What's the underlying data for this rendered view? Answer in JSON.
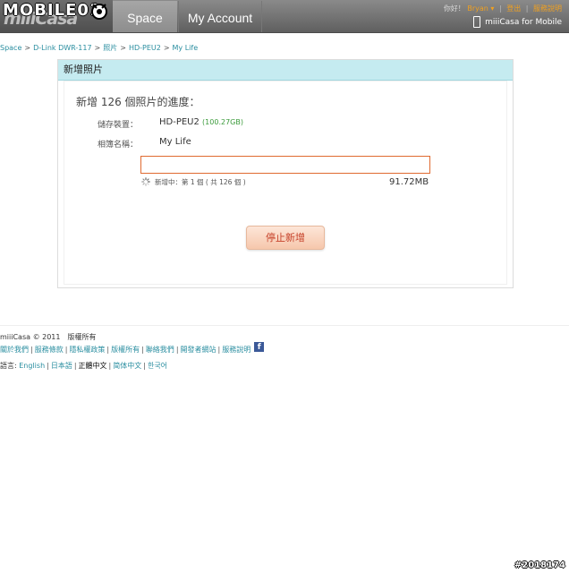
{
  "watermark": {
    "top": "MOBILE01",
    "bottom": "#2018174"
  },
  "brand": {
    "logo_text": "miiiCasa"
  },
  "nav": {
    "tabs": [
      {
        "label": "Space"
      },
      {
        "label": "My Account"
      }
    ]
  },
  "user_bar": {
    "greeting": "你好！",
    "username": "Bryan",
    "logout": "登出",
    "help": "服務說明",
    "mobile_link": "miiiCasa for Mobile"
  },
  "breadcrumb": [
    "Space",
    "D-Link DWR-117",
    "照片",
    "HD-PEU2",
    "My Life"
  ],
  "panel": {
    "title": "新增照片",
    "progress_title": "新增 126 個照片的進度：",
    "device_label": "儲存裝置：",
    "device_value": "HD-PEU2",
    "device_capacity": "(100.27GB)",
    "album_label": "相簿名稱：",
    "album_value": "My Life",
    "progress_fraction": 0,
    "status_text": "新增中：第 1 個 ( 共 126 個 )",
    "size_text": "91.72MB",
    "stop_button": "停止新增"
  },
  "footer": {
    "copyright": "miiiCasa © 2011　版權所有",
    "links": [
      "關於我們",
      "服務條款",
      "隱私權政策",
      "版權所有",
      "聯絡我們",
      "開發者網站",
      "服務說明"
    ],
    "lang_label": "語言:",
    "languages": [
      "English",
      "日本語",
      "正體中文",
      "简体中文",
      "한국어"
    ],
    "current_language": "正體中文"
  },
  "colors": {
    "accent": "#2a8ea0",
    "header_bg": "#c5ebf0",
    "progress_border": "#e06a30",
    "button_text": "#c6422a",
    "user_highlight": "#f0a020"
  }
}
